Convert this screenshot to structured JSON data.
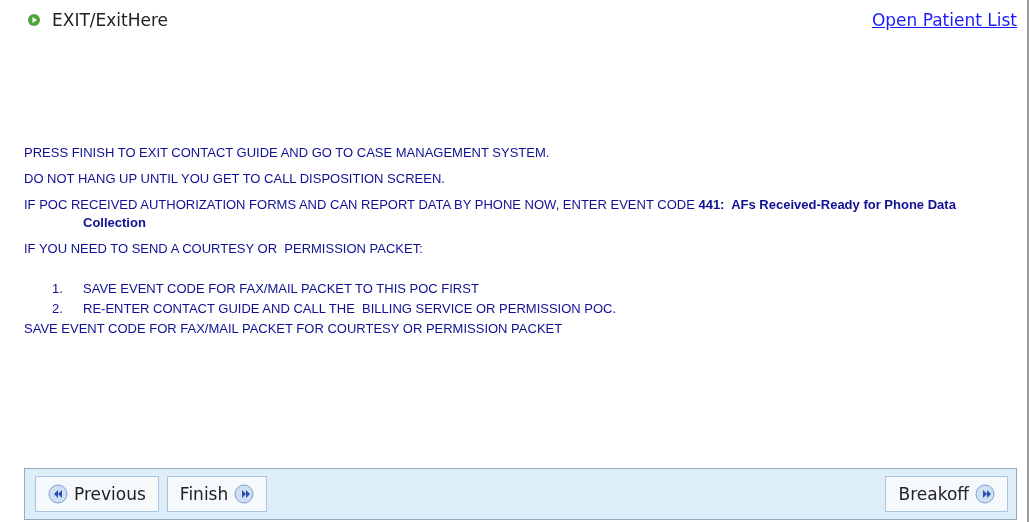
{
  "header": {
    "title": "EXIT/ExitHere",
    "link": "Open Patient List"
  },
  "instructions": [
    {
      "kind": "line",
      "text": "PRESS FINISH TO EXIT CONTACT GUIDE AND GO TO CASE MANAGEMENT SYSTEM."
    },
    {
      "kind": "line",
      "text": "DO NOT HANG UP UNTIL YOU GET TO CALL DISPOSITION SCREEN."
    },
    {
      "kind": "line",
      "text": "IF POC RECEIVED AUTHORIZATION FORMS AND CAN REPORT DATA BY PHONE NOW, ENTER EVENT CODE **441:  AFs Received-Ready for Phone Data Collection**"
    },
    {
      "kind": "line",
      "text": "IF YOU NEED TO SEND A COURTESY OR  PERMISSION PACKET:"
    },
    {
      "kind": "numbered",
      "number": "1.",
      "text": "SAVE EVENT CODE FOR FAX/MAIL PACKET TO THIS POC FIRST"
    },
    {
      "kind": "numbered",
      "number": "2.",
      "text": "RE-ENTER CONTACT GUIDE AND CALL THE  BILLING SERVICE OR PERMISSION POC."
    },
    {
      "kind": "line",
      "text": "SAVE EVENT CODE FOR FAX/MAIL PACKET FOR COURTESY OR PERMISSION PACKET"
    }
  ],
  "left_buttons": [
    {
      "label": "Previous",
      "kind": "back"
    },
    {
      "label": "Finish",
      "kind": "forward"
    }
  ],
  "right_buttons": [
    {
      "label": "Breakoff",
      "kind": "forward"
    }
  ]
}
